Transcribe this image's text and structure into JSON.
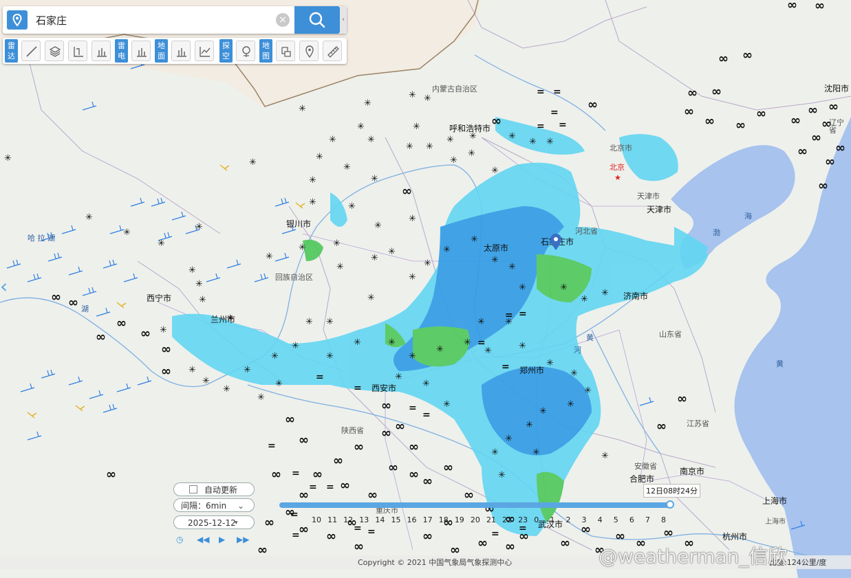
{
  "search": {
    "value": "石家庄",
    "clear_glyph": "×"
  },
  "toolbar": {
    "cat_radar": "雷达",
    "cat_lightning": "雷电",
    "cat_ground": "地面",
    "cat_sounding": "探空",
    "cat_map": "地图"
  },
  "map_labels": {
    "inner_mongolia": "内蒙古自治区",
    "hohhot": "呼和浩特市",
    "yinchuan": "银川市",
    "ningxia": "回族自治区",
    "xining": "西宁市",
    "lanzhou": "兰州市",
    "taiyuan": "太原市",
    "shijiazhuang": "石家庄市",
    "hebei": "河北省",
    "beijing_city": "北京市",
    "beijing": "北京",
    "tianjin_city": "天津市",
    "tianjin": "天津市",
    "jinan": "济南市",
    "shandong": "山东省",
    "xian": "西安市",
    "shaanxi": "陕西省",
    "zhengzhou": "郑州市",
    "jiangsu": "江苏省",
    "anhui": "安徽省",
    "hefei": "合肥市",
    "nanjing": "南京市",
    "shanghai": "上海市",
    "shanghai2": "上海市",
    "hangzhou": "杭州市",
    "wuhan": "武汉市",
    "chongqing": "重庆市",
    "shenyang": "沈阳市",
    "liaoning": "辽宁省",
    "bohai": "渤",
    "sea": "海",
    "yellow_sea": "黄",
    "hala_lake": "哈 拉 湖",
    "yellow_river": "黄",
    "river": "河",
    "hu": "湖"
  },
  "marker_label": "石家庄市",
  "time": {
    "auto_update": "自动更新",
    "interval": "间隔：6min",
    "date": "2025-12-12",
    "current": "12日08时24分",
    "ticks": [
      "10",
      "11",
      "12",
      "13",
      "14",
      "15",
      "16",
      "17",
      "18",
      "19",
      "20",
      "21",
      "22",
      "23",
      "0",
      "1",
      "2",
      "3",
      "4",
      "5",
      "6",
      "7",
      "8"
    ]
  },
  "footer": {
    "copyright": "Copyright © 2021 中国气象局气象探测中心",
    "scale": "比度:124公里/度",
    "watermark": "@weatherman_信欣"
  },
  "colors": {
    "accent": "#3d8fd8",
    "echo_light": "#63d6f2",
    "echo_mid": "#2f9be6",
    "echo_green": "#4ec85a",
    "sea": "#a7c3ee"
  }
}
